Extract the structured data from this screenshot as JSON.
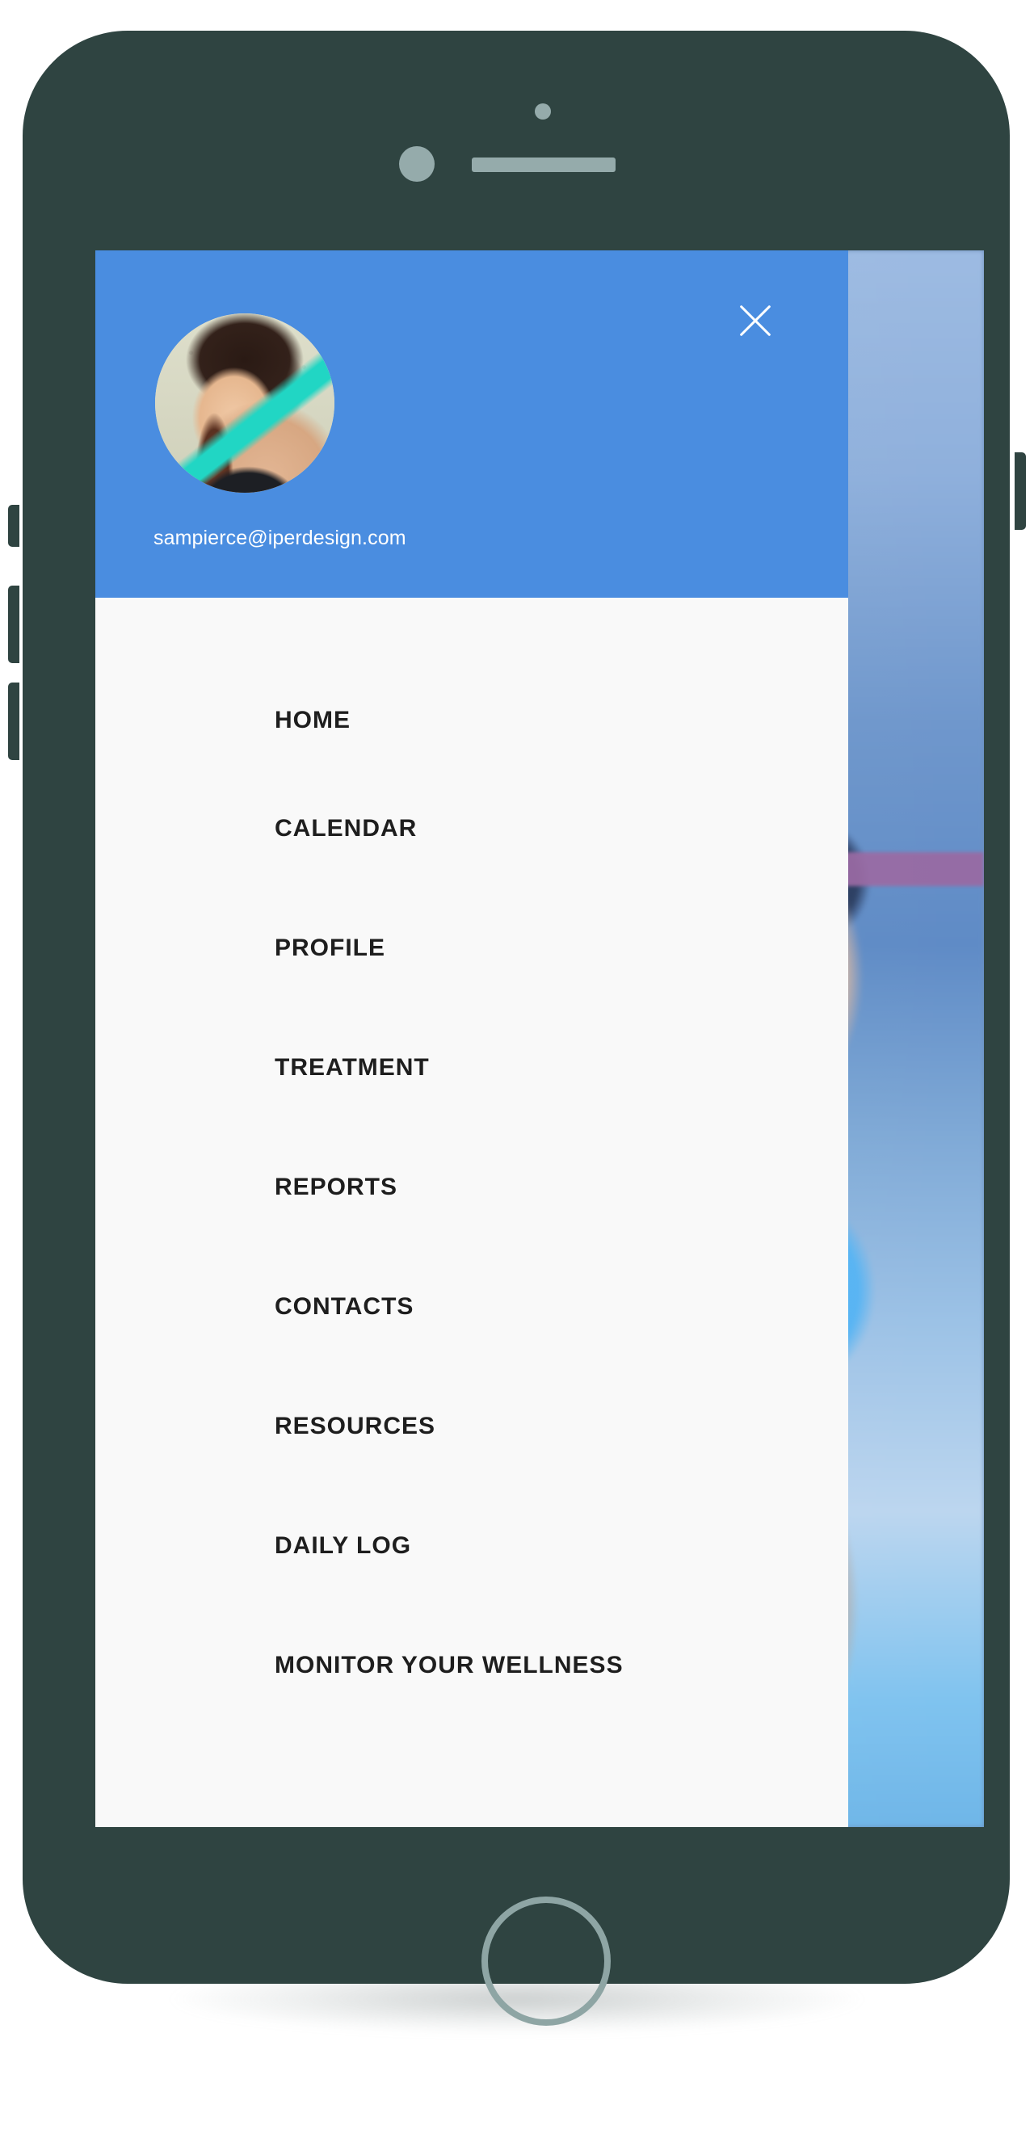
{
  "device": {
    "frame_color": "#2f4441",
    "hardware_color": "#95abab",
    "home_button_label": "home-button",
    "buttons": [
      {
        "name": "silent-switch"
      },
      {
        "name": "volume-up-button"
      },
      {
        "name": "volume-down-button"
      },
      {
        "name": "power-button"
      }
    ]
  },
  "screen": {
    "background_image_alt": "woman running outdoors",
    "accent_color": "#4a8de0",
    "drawer_background": "#f9f9f9"
  },
  "drawer": {
    "header": {
      "avatar_alt": "user profile photo",
      "email": "sampierce@iperdesign.com",
      "close_icon": "close-icon"
    },
    "nav_items": [
      {
        "id": "home",
        "label": "HOME"
      },
      {
        "id": "calendar",
        "label": "CALENDAR"
      },
      {
        "id": "profile",
        "label": "PROFILE"
      },
      {
        "id": "treatment",
        "label": "TREATMENT"
      },
      {
        "id": "reports",
        "label": "REPORTS"
      },
      {
        "id": "contacts",
        "label": "CONTACTS"
      },
      {
        "id": "resources",
        "label": "RESOURCES"
      },
      {
        "id": "daily-log",
        "label": "DAILY LOG"
      },
      {
        "id": "monitor-wellness",
        "label": "MONITOR YOUR WELLNESS"
      }
    ]
  }
}
